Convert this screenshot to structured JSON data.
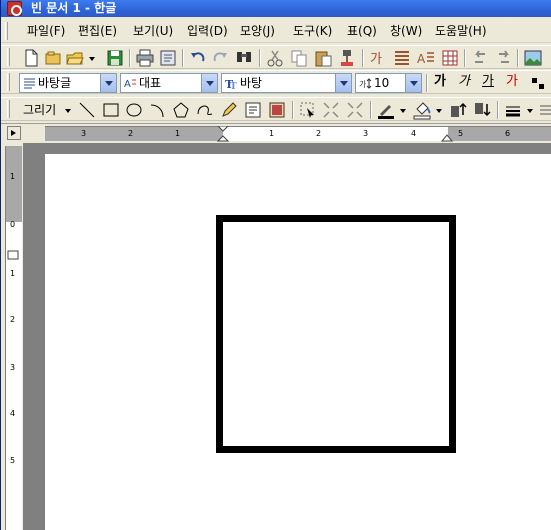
{
  "window": {
    "title": "빈 문서 1 - 한글"
  },
  "menubar": {
    "items": [
      "파일(F)",
      "편집(E)",
      "보기(U)",
      "입력(D)",
      "모양(J)",
      "도구(K)",
      "표(Q)",
      "창(W)",
      "도움말(H)"
    ]
  },
  "standard_toolbar": {
    "icons": [
      "new-document-icon",
      "open-folder-icon",
      "open-file-icon",
      "save-icon",
      "print-icon",
      "print-preview-icon",
      "undo-icon",
      "redo-icon",
      "find-icon",
      "cut-icon",
      "copy-icon",
      "paste-icon",
      "format-painter-icon",
      "char-shape-icon",
      "para-shape-icon",
      "style-icon",
      "table-icon",
      "back-icon",
      "forward-icon",
      "image-icon"
    ]
  },
  "format_toolbar": {
    "style_value": "바탕글",
    "representative_value": "대표",
    "font_value": "바탕",
    "size_value": "10",
    "glyphs": [
      "가",
      "가",
      "가",
      "가"
    ]
  },
  "drawing_toolbar": {
    "label": "그리기",
    "icons": [
      "line-icon",
      "rectangle-icon",
      "ellipse-icon",
      "arc-icon",
      "polygon-icon",
      "curve-icon",
      "pencil-icon",
      "textbox-icon",
      "picture-icon",
      "select-object-icon",
      "group-icon",
      "ungroup-icon",
      "line-color-icon",
      "fill-color-icon",
      "bring-front-icon",
      "send-back-icon",
      "line-style-icon"
    ]
  },
  "ruler": {
    "horizontal_labels": [
      "3",
      "2",
      "1",
      "1",
      "2",
      "3",
      "4",
      "5",
      "6"
    ],
    "vertical_labels": [
      "1",
      "0",
      "1",
      "2",
      "3",
      "4",
      "5"
    ]
  },
  "colors": {
    "titlebar": "#2e63d6",
    "chrome": "#ece9d8",
    "canvas_gray": "#808080",
    "shape_stroke": "#000000"
  }
}
